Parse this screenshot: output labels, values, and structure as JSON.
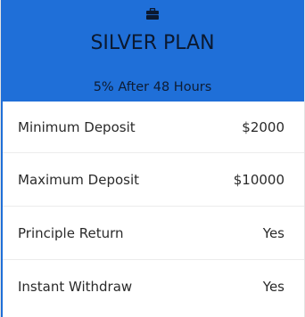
{
  "plan": {
    "icon": "briefcase-icon",
    "title": "SILVER PLAN",
    "subtitle": "5% After 48 Hours",
    "accent_color": "#1f6fd8",
    "rows": [
      {
        "label": "Minimum Deposit",
        "value": "$2000"
      },
      {
        "label": "Maximum Deposit",
        "value": "$10000"
      },
      {
        "label": "Principle Return",
        "value": "Yes"
      },
      {
        "label": "Instant Withdraw",
        "value": "Yes"
      }
    ]
  }
}
